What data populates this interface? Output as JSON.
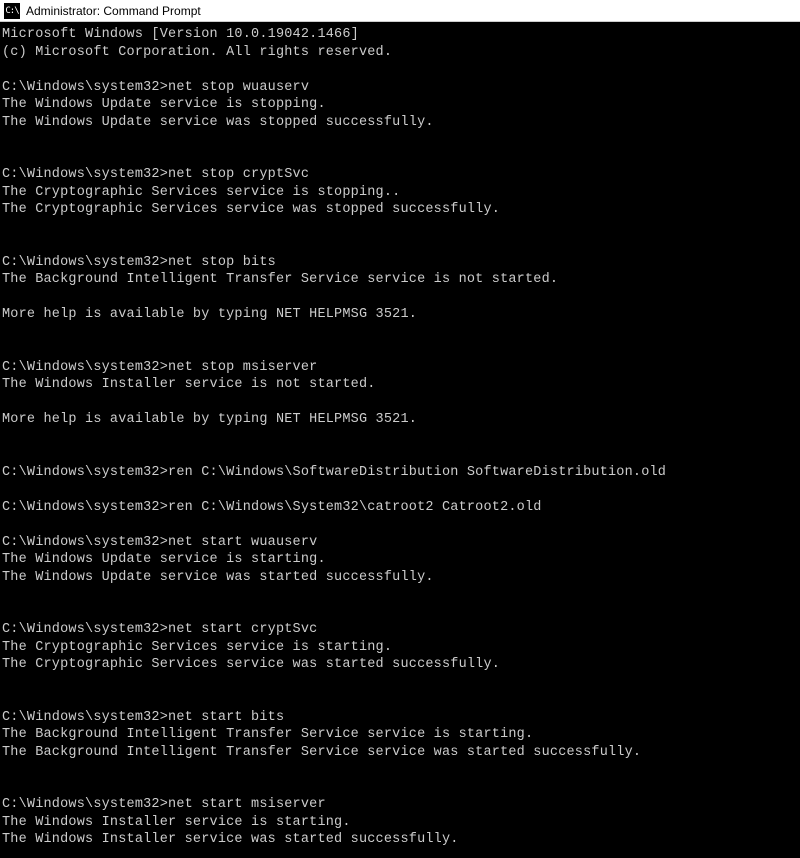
{
  "window": {
    "title": "Administrator: Command Prompt",
    "icon_label": "cmd-icon"
  },
  "console": {
    "prompt": "C:\\Windows\\system32>",
    "lines": [
      "Microsoft Windows [Version 10.0.19042.1466]",
      "(c) Microsoft Corporation. All rights reserved.",
      "",
      "C:\\Windows\\system32>net stop wuauserv",
      "The Windows Update service is stopping.",
      "The Windows Update service was stopped successfully.",
      "",
      "",
      "C:\\Windows\\system32>net stop cryptSvc",
      "The Cryptographic Services service is stopping..",
      "The Cryptographic Services service was stopped successfully.",
      "",
      "",
      "C:\\Windows\\system32>net stop bits",
      "The Background Intelligent Transfer Service service is not started.",
      "",
      "More help is available by typing NET HELPMSG 3521.",
      "",
      "",
      "C:\\Windows\\system32>net stop msiserver",
      "The Windows Installer service is not started.",
      "",
      "More help is available by typing NET HELPMSG 3521.",
      "",
      "",
      "C:\\Windows\\system32>ren C:\\Windows\\SoftwareDistribution SoftwareDistribution.old",
      "",
      "C:\\Windows\\system32>ren C:\\Windows\\System32\\catroot2 Catroot2.old",
      "",
      "C:\\Windows\\system32>net start wuauserv",
      "The Windows Update service is starting.",
      "The Windows Update service was started successfully.",
      "",
      "",
      "C:\\Windows\\system32>net start cryptSvc",
      "The Cryptographic Services service is starting.",
      "The Cryptographic Services service was started successfully.",
      "",
      "",
      "C:\\Windows\\system32>net start bits",
      "The Background Intelligent Transfer Service service is starting.",
      "The Background Intelligent Transfer Service service was started successfully.",
      "",
      "",
      "C:\\Windows\\system32>net start msiserver",
      "The Windows Installer service is starting.",
      "The Windows Installer service was started successfully."
    ]
  }
}
